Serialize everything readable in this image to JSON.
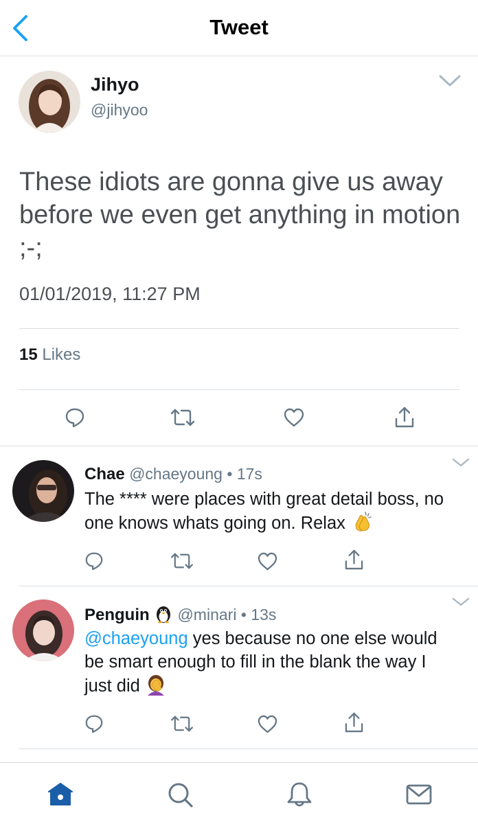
{
  "header": {
    "title": "Tweet"
  },
  "main_tweet": {
    "name": "Jihyo",
    "handle": "@jihyoo",
    "text": "These idiots are gonna give us away before we even get anything in motion ;-;",
    "timestamp": "01/01/2019, 11:27 PM",
    "likes_count": "15",
    "likes_label": "Likes"
  },
  "replies": [
    {
      "name": "Chae",
      "handle": "@chaeyoung",
      "dot": "•",
      "age": "17s",
      "text": "The **** were places with great detail boss, no one knows whats going on. Relax",
      "emoji": "clapping-hands-icon"
    },
    {
      "name": "Penguin",
      "name_emoji": "penguin-icon",
      "handle": "@minari",
      "dot": "•",
      "age": "13s",
      "mention": "@chaeyoung",
      "text": "yes because no one else would be smart enough to fill in the blank the way I just did",
      "emoji": "woman-facepalming-icon"
    }
  ],
  "colors": {
    "accent": "#1da1f2",
    "nav_active": "#1b5ea8",
    "secondary_text": "#657786",
    "icon_gray": "#657786",
    "divider": "#d8dde2"
  },
  "bottom_nav": [
    "home-icon",
    "search-icon",
    "notifications-icon",
    "messages-icon"
  ]
}
